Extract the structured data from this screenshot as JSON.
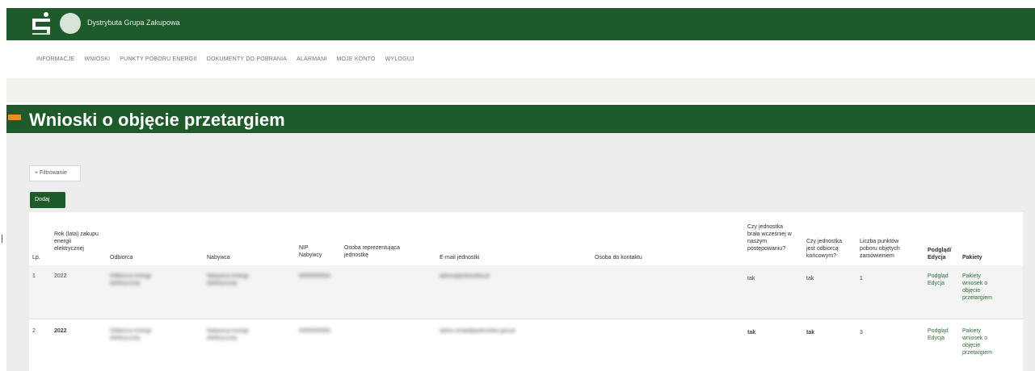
{
  "header": {
    "brand_name": "Dystrybuta Grupa Zakupowa",
    "colors": {
      "header": "#1f5a2b",
      "accent": "#f28c28"
    }
  },
  "nav": {
    "items": [
      "INFORMACJE",
      "WNIOSKI",
      "PUNKTY POBORU ENERGII",
      "DOKUMENTY DO POBRANIA",
      "ALARMANI",
      "MOJE KONTO",
      "WYLOGUJ"
    ]
  },
  "page": {
    "title": "Wnioski o objęcie przetargiem"
  },
  "actions": {
    "filter_label": "+ Filtrowanie",
    "new_label": "Dodaj"
  },
  "table": {
    "headers": {
      "lp": "Lp.",
      "rok": "Rok (lata) zakupu energii elektrycznej",
      "odbiorca": "Odbiorca",
      "nabywca": "Nabywca",
      "nip": "NIP Nabywcy",
      "osoba": "Osoba reprezentująca jednostkę",
      "email": "E-mail jednostki",
      "kontakt": "Osoba do kontaktu",
      "wczesniej": "Czy jednostka brała wcześniej w naszym postępowaniu?",
      "odbiorca_koncowy": "Czy jednostka jest odbiorcą końcowym?",
      "liczba": "Liczba punktów poboru objętych zamówieniem",
      "podglad": "Podgląd/ Edycja",
      "pakiety": "Pakiety"
    },
    "rows": [
      {
        "lp": "1",
        "rok": "2022",
        "odbiorca": "Odbiorca energii elektrycznej",
        "nabywca": "Nabywca energii elektrycznej",
        "nip": "0000000000",
        "email": "adres@jednostka.pl",
        "wczesniej": "tak",
        "odbiorca_koncowy": "tak",
        "liczba": "1",
        "podglad": "Podgląd",
        "edycja": "Edycja",
        "pakiety": "Pakiety wniosek o objęcie przetargiem"
      },
      {
        "lp": "2",
        "rok": "2022",
        "odbiorca": "Odbiorca energii elektrycznej",
        "nabywca": "Nabywca energii elektrycznej",
        "nip": "0000000000",
        "email": "adres.email@jednostka.gov.pl",
        "wczesniej": "tak",
        "odbiorca_koncowy": "tak",
        "liczba": "3",
        "podglad": "Podgląd",
        "edycja": "Edycja",
        "pakiety": "Pakiety wniosek o objęcie przetargiem"
      }
    ]
  }
}
